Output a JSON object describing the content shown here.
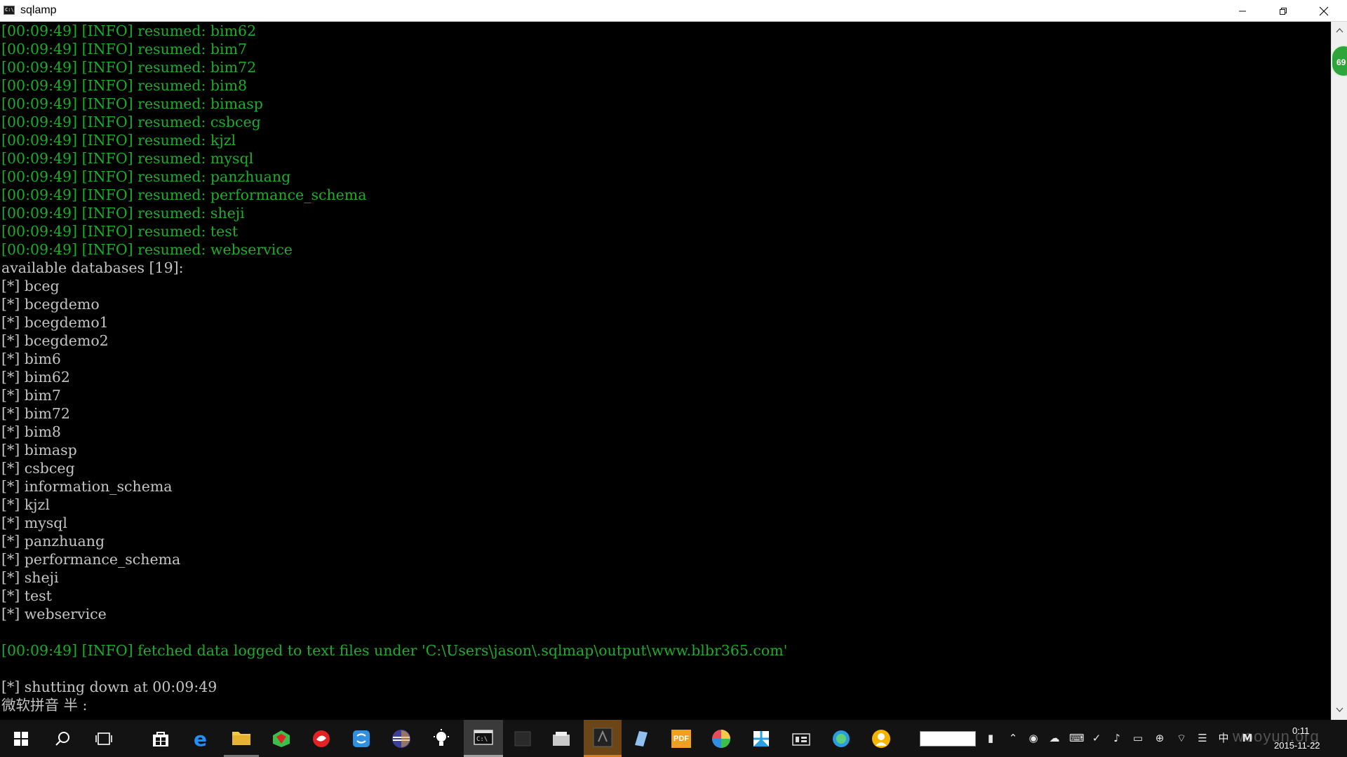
{
  "window": {
    "title": "sqlamp",
    "icon": "console-app-icon"
  },
  "console": {
    "log_lines": [
      "[00:09:49] [INFO] resumed: bim62",
      "[00:09:49] [INFO] resumed: bim7",
      "[00:09:49] [INFO] resumed: bim72",
      "[00:09:49] [INFO] resumed: bim8",
      "[00:09:49] [INFO] resumed: bimasp",
      "[00:09:49] [INFO] resumed: csbceg",
      "[00:09:49] [INFO] resumed: kjzl",
      "[00:09:49] [INFO] resumed: mysql",
      "[00:09:49] [INFO] resumed: panzhuang",
      "[00:09:49] [INFO] resumed: performance_schema",
      "[00:09:49] [INFO] resumed: sheji",
      "[00:09:49] [INFO] resumed: test",
      "[00:09:49] [INFO] resumed: webservice"
    ],
    "databases_header": "available databases [19]:",
    "databases": [
      "[*] bceg",
      "[*] bcegdemo",
      "[*] bcegdemo1",
      "[*] bcegdemo2",
      "[*] bim6",
      "[*] bim62",
      "[*] bim7",
      "[*] bim72",
      "[*] bim8",
      "[*] bimasp",
      "[*] csbceg",
      "[*] information_schema",
      "[*] kjzl",
      "[*] mysql",
      "[*] panzhuang",
      "[*] performance_schema",
      "[*] sheji",
      "[*] test",
      "[*] webservice"
    ],
    "fetched_line": "[00:09:49] [INFO] fetched data logged to text files under 'C:\\Users\\jason\\.sqlmap\\output\\www.blbr365.com'",
    "shutdown_line": "[*] shutting down at 00:09:49",
    "ime_line": "微软拼音 半 :"
  },
  "float_badge": "69",
  "taskbar": {
    "apps": [
      {
        "name": "start-button-icon",
        "color": "#ffffff"
      },
      {
        "name": "search-icon",
        "color": "#ffffff"
      },
      {
        "name": "task-view-icon",
        "color": "#ffffff"
      },
      {
        "name": "store-icon",
        "color": "#ffffff"
      },
      {
        "name": "edge-icon",
        "color": "#1e90ff"
      },
      {
        "name": "file-explorer-icon",
        "color": "#f2c94c"
      },
      {
        "name": "app-icon-1",
        "color": "#3cbf4a"
      },
      {
        "name": "app-icon-2",
        "color": "#e02424"
      },
      {
        "name": "app-icon-3",
        "color": "#2f8fe0"
      },
      {
        "name": "eclipse-icon",
        "color": "#3b3f9a"
      },
      {
        "name": "lightbulb-icon",
        "color": "#ffffff"
      },
      {
        "name": "terminal-icon",
        "color": "#e0e0e0"
      },
      {
        "name": "app-icon-4",
        "color": "#2a2a2a"
      },
      {
        "name": "app-icon-5",
        "color": "#c8c8c8"
      },
      {
        "name": "app-icon-6",
        "color": "#222222"
      },
      {
        "name": "app-icon-7",
        "color": "#8fc0f0"
      },
      {
        "name": "pdf-icon",
        "color": "#f0a020"
      },
      {
        "name": "app-icon-8",
        "color": "#e84a5f"
      },
      {
        "name": "app-icon-9",
        "color": "#2aa0e0"
      },
      {
        "name": "app-icon-10",
        "color": "#dddddd"
      },
      {
        "name": "app-icon-11",
        "color": "#2a9de0"
      },
      {
        "name": "app-icon-12",
        "color": "#f5b400"
      }
    ],
    "pdf_label": "PDF",
    "tray_ime": "中",
    "tray_ime2": "M",
    "clock_time": "0:11",
    "clock_date": "2015-11-22",
    "watermark": "wooyun.org"
  }
}
